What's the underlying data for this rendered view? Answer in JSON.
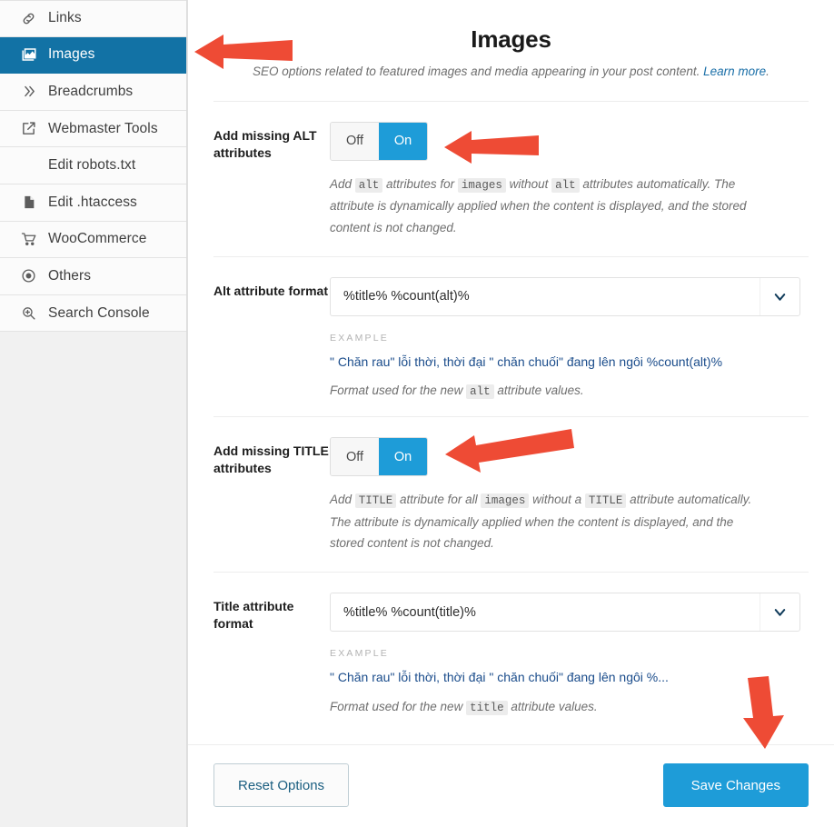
{
  "sidebar": {
    "items": [
      {
        "label": "Links",
        "icon": "link-icon",
        "active": false
      },
      {
        "label": "Images",
        "icon": "images-icon",
        "active": true
      },
      {
        "label": "Breadcrumbs",
        "icon": "chevrons-icon",
        "active": false
      },
      {
        "label": "Webmaster Tools",
        "icon": "external-link-icon",
        "active": false
      },
      {
        "label": "Edit robots.txt",
        "icon": "none",
        "active": false
      },
      {
        "label": "Edit .htaccess",
        "icon": "document-icon",
        "active": false
      },
      {
        "label": "WooCommerce",
        "icon": "cart-icon",
        "active": false
      },
      {
        "label": "Others",
        "icon": "target-icon",
        "active": false
      },
      {
        "label": "Search Console",
        "icon": "search-zoom-icon",
        "active": false
      }
    ]
  },
  "header": {
    "title": "Images",
    "subtitle": "SEO options related to featured images and media appearing in your post content.",
    "link_label": "Learn more",
    "link_suffix": "."
  },
  "rows": {
    "alt_toggle": {
      "label": "Add missing ALT attributes",
      "off_label": "Off",
      "on_label": "On",
      "selected": "On",
      "desc_1": "Add ",
      "code_1": "alt",
      "desc_2": " attributes for ",
      "code_2": "images",
      "desc_3": " without ",
      "code_3": "alt",
      "desc_4": " attributes automatically. The attribute is dynamically applied when the content is displayed, and the stored content is not changed."
    },
    "alt_format": {
      "label": "Alt attribute format",
      "value": "%title% %count(alt)%",
      "example_label": "EXAMPLE",
      "example_text": "\" Chăn rau\" lỗi thời, thời đại \" chăn chuối\" đang lên ngôi %count(alt)%",
      "hint_1": "Format used for the new ",
      "hint_code": "alt",
      "hint_2": " attribute values."
    },
    "title_toggle": {
      "label": "Add missing TITLE attributes",
      "off_label": "Off",
      "on_label": "On",
      "selected": "On",
      "desc_1": "Add ",
      "code_1": "TITLE",
      "desc_2": " attribute for all ",
      "code_2": "images",
      "desc_3": " without a ",
      "code_3": "TITLE",
      "desc_4": " attribute automatically. The attribute is dynamically applied when the content is displayed, and the stored content is not changed."
    },
    "title_format": {
      "label": "Title attribute format",
      "value": "%title% %count(title)%",
      "example_label": "EXAMPLE",
      "example_text": "\" Chăn rau\" lỗi thời, thời đại \" chăn chuối\" đang lên ngôi %...",
      "hint_1": "Format used for the new ",
      "hint_code": "title",
      "hint_2": " attribute values."
    }
  },
  "footer": {
    "reset_label": "Reset Options",
    "save_label": "Save Changes"
  },
  "annotations": {
    "arrow_color": "#ee4b35",
    "arrows": [
      {
        "name": "arrow-pointing-images-nav",
        "direction": "left"
      },
      {
        "name": "arrow-pointing-alt-toggle",
        "direction": "left"
      },
      {
        "name": "arrow-pointing-title-toggle",
        "direction": "left"
      },
      {
        "name": "arrow-pointing-save-changes",
        "direction": "down"
      }
    ]
  },
  "colors": {
    "accent_blue": "#1e9cd8",
    "sidebar_active": "#1272a5",
    "link_blue": "#1a6fa8",
    "example_blue": "#1a4c8b",
    "arrow_red": "#ee4b35"
  }
}
